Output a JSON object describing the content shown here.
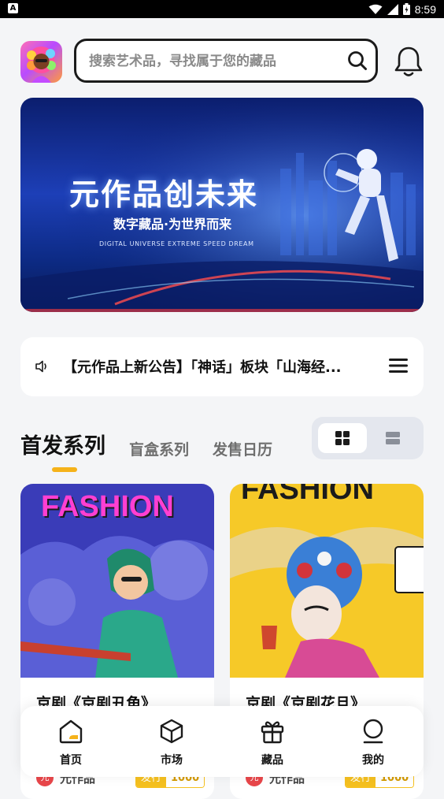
{
  "status_bar": {
    "time": "8:59",
    "left_icon": "A"
  },
  "header": {
    "search": {
      "placeholder": "搜索艺术品，寻找属于您的藏品"
    }
  },
  "banner": {
    "title": "元作品创未来",
    "subtitle": "数字藏品·为世界而来",
    "english": "DIGITAL UNIVERSE EXTREME SPEED DREAM"
  },
  "notice": {
    "text": "【元作品上新公告】「神话」板块「山海经..."
  },
  "tabs": [
    {
      "label": "首发系列",
      "active": true
    },
    {
      "label": "盲盒系列",
      "active": false
    },
    {
      "label": "发售日历",
      "active": false
    }
  ],
  "cards": [
    {
      "title": "京剧《京剧丑角》",
      "image_text": "FASHION",
      "author": "元作品",
      "badge_label": "发行",
      "badge_value": "1000"
    },
    {
      "title": "京剧《京剧花旦》",
      "image_text": "FASHION",
      "author": "元作品",
      "badge_label": "发行",
      "badge_value": "1000"
    }
  ],
  "bottom_nav": [
    {
      "label": "首页",
      "icon": "home-icon"
    },
    {
      "label": "市场",
      "icon": "cube-icon"
    },
    {
      "label": "藏品",
      "icon": "gift-icon"
    },
    {
      "label": "我的",
      "icon": "user-icon"
    }
  ],
  "colors": {
    "accent": "#f5b21a",
    "badge": "#f5c01f",
    "banner": "#1d3fb7"
  }
}
